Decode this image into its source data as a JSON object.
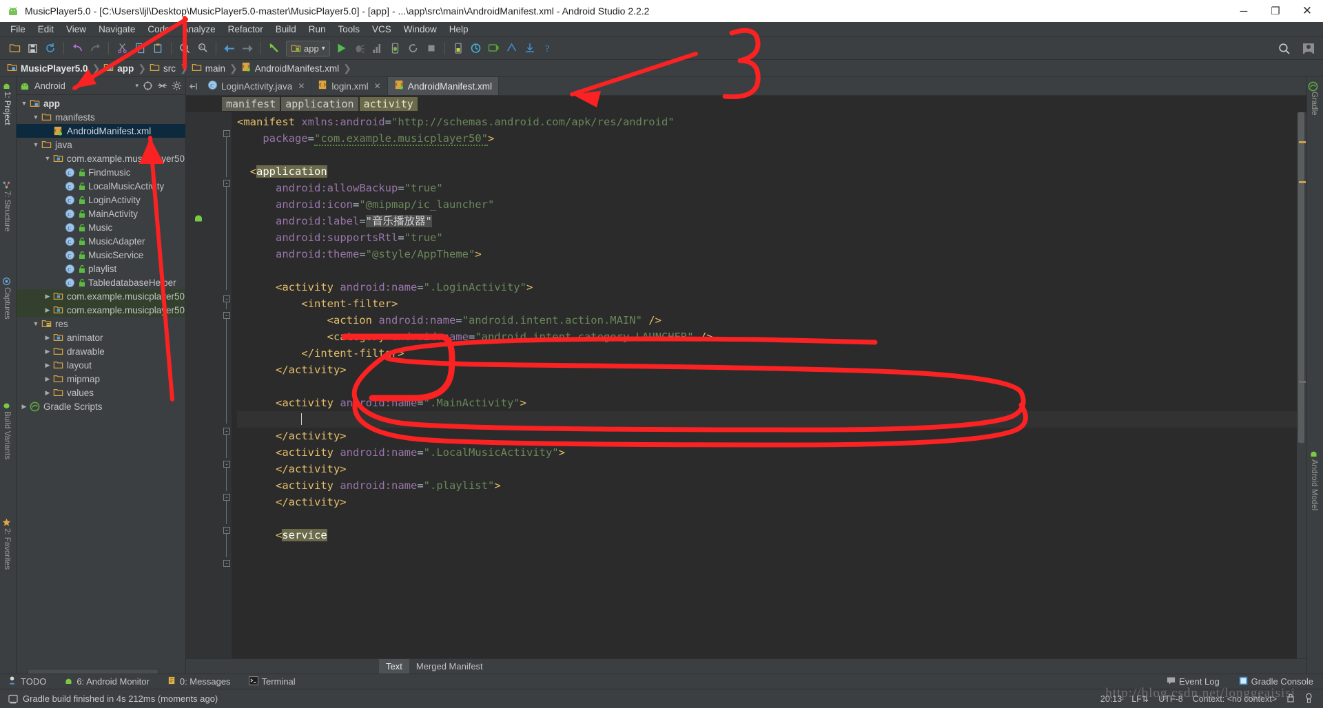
{
  "window": {
    "title": "MusicPlayer5.0 - [C:\\Users\\ljl\\Desktop\\MusicPlayer5.0-master\\MusicPlayer5.0] - [app] - ...\\app\\src\\main\\AndroidManifest.xml - Android Studio 2.2.2",
    "minimize": "─",
    "maximize": "❐",
    "close": "✕"
  },
  "menu": [
    "File",
    "Edit",
    "View",
    "Navigate",
    "Code",
    "Analyze",
    "Refactor",
    "Build",
    "Run",
    "Tools",
    "VCS",
    "Window",
    "Help"
  ],
  "toolbar": {
    "run_config": "app",
    "dropdown_caret": "▾",
    "search_icon": "search-icon",
    "avatar_icon": "user-icon"
  },
  "breadcrumb": [
    {
      "label": "MusicPlayer5.0",
      "icon": "module-folder-icon",
      "bold": true
    },
    {
      "label": "app",
      "icon": "module-folder-icon",
      "bold": true
    },
    {
      "label": "src",
      "icon": "folder-icon",
      "bold": false
    },
    {
      "label": "main",
      "icon": "folder-icon",
      "bold": false
    },
    {
      "label": "AndroidManifest.xml",
      "icon": "manifest-file-icon",
      "bold": false
    }
  ],
  "left_rail": [
    {
      "label": "1: Project",
      "icon": "android-icon",
      "selected": true
    },
    {
      "label": "7: Structure",
      "icon": "structure-icon",
      "selected": false
    },
    {
      "label": "Captures",
      "icon": "captures-icon",
      "selected": false
    },
    {
      "label": "Build Variants",
      "icon": "variants-icon",
      "selected": false
    },
    {
      "label": "2: Favorites",
      "icon": "star-icon",
      "selected": false
    }
  ],
  "right_rail": [
    {
      "label": "Gradle",
      "icon": "gradle-icon"
    },
    {
      "label": "Android Model",
      "icon": "android-model-icon"
    }
  ],
  "project_panel": {
    "view_name": "Android",
    "caret": "▾",
    "tools": [
      "target-icon",
      "collapse-all-icon",
      "gear-icon"
    ],
    "tree": [
      {
        "depth": 0,
        "arrow": "▼",
        "icon": "module-folder-icon",
        "label": "app",
        "bold": true,
        "state": "normal"
      },
      {
        "depth": 1,
        "arrow": "▼",
        "icon": "folder-icon",
        "label": "manifests",
        "bold": false,
        "state": "normal"
      },
      {
        "depth": 2,
        "arrow": "",
        "icon": "manifest-file-icon",
        "label": "AndroidManifest.xml",
        "bold": false,
        "state": "selected"
      },
      {
        "depth": 1,
        "arrow": "▼",
        "icon": "folder-icon",
        "label": "java",
        "bold": false,
        "state": "normal"
      },
      {
        "depth": 2,
        "arrow": "▼",
        "icon": "package-icon",
        "label": "com.example.musicplayer50",
        "bold": false,
        "state": "normal"
      },
      {
        "depth": 3,
        "arrow": "",
        "icon": "class-icon",
        "lock": true,
        "label": "Findmusic",
        "bold": false,
        "state": "normal"
      },
      {
        "depth": 3,
        "arrow": "",
        "icon": "class-icon",
        "lock": true,
        "label": "LocalMusicActivity",
        "bold": false,
        "state": "normal"
      },
      {
        "depth": 3,
        "arrow": "",
        "icon": "class-icon",
        "lock": true,
        "label": "LoginActivity",
        "bold": false,
        "state": "normal"
      },
      {
        "depth": 3,
        "arrow": "",
        "icon": "class-icon",
        "lock": true,
        "label": "MainActivity",
        "bold": false,
        "state": "normal"
      },
      {
        "depth": 3,
        "arrow": "",
        "icon": "class-icon",
        "lock": true,
        "label": "Music",
        "bold": false,
        "state": "normal"
      },
      {
        "depth": 3,
        "arrow": "",
        "icon": "class-icon",
        "lock": true,
        "label": "MusicAdapter",
        "bold": false,
        "state": "normal"
      },
      {
        "depth": 3,
        "arrow": "",
        "icon": "class-icon",
        "lock": true,
        "label": "MusicService",
        "bold": false,
        "state": "normal"
      },
      {
        "depth": 3,
        "arrow": "",
        "icon": "class-icon",
        "lock": true,
        "label": "playlist",
        "bold": false,
        "state": "normal"
      },
      {
        "depth": 3,
        "arrow": "",
        "icon": "class-icon",
        "lock": true,
        "label": "TabledatabaseHelper",
        "bold": false,
        "state": "normal"
      },
      {
        "depth": 2,
        "arrow": "▶",
        "icon": "package-icon",
        "label": "com.example.musicplayer50",
        "bold": false,
        "state": "greenish"
      },
      {
        "depth": 2,
        "arrow": "▶",
        "icon": "package-icon",
        "label": "com.example.musicplayer50",
        "bold": false,
        "state": "greenish"
      },
      {
        "depth": 1,
        "arrow": "▼",
        "icon": "res-folder-icon",
        "label": "res",
        "bold": false,
        "state": "normal"
      },
      {
        "depth": 2,
        "arrow": "▶",
        "icon": "package-icon",
        "label": "animator",
        "bold": false,
        "state": "normal"
      },
      {
        "depth": 2,
        "arrow": "▶",
        "icon": "folder-icon",
        "label": "drawable",
        "bold": false,
        "state": "normal"
      },
      {
        "depth": 2,
        "arrow": "▶",
        "icon": "folder-icon",
        "label": "layout",
        "bold": false,
        "state": "normal"
      },
      {
        "depth": 2,
        "arrow": "▶",
        "icon": "folder-icon",
        "label": "mipmap",
        "bold": false,
        "state": "normal"
      },
      {
        "depth": 2,
        "arrow": "▶",
        "icon": "folder-icon",
        "label": "values",
        "bold": false,
        "state": "normal"
      },
      {
        "depth": 0,
        "arrow": "▶",
        "icon": "gradle-icon",
        "label": "Gradle Scripts",
        "bold": false,
        "state": "normal"
      }
    ]
  },
  "editor": {
    "tabs": [
      {
        "label": "LoginActivity.java",
        "icon": "java-class-icon",
        "active": false,
        "close": "✕"
      },
      {
        "label": "login.xml",
        "icon": "xml-file-icon",
        "active": false,
        "close": "✕"
      },
      {
        "label": "AndroidManifest.xml",
        "icon": "manifest-file-icon",
        "active": true,
        "close": ""
      }
    ],
    "xml_breadcrumb": [
      {
        "label": "manifest",
        "selected": false
      },
      {
        "label": "application",
        "selected": false
      },
      {
        "label": "activity",
        "selected": true
      }
    ],
    "bottom_tabs": [
      {
        "label": "Text",
        "active": true
      },
      {
        "label": "Merged Manifest",
        "active": false
      }
    ],
    "code_lines": [
      {
        "indent": 0,
        "tokens": [
          {
            "t": "<manifest",
            "c": "tag"
          },
          {
            "t": " ",
            "c": "plain"
          },
          {
            "t": "xmlns:android",
            "c": "attr"
          },
          {
            "t": "=",
            "c": "plain"
          },
          {
            "t": "\"http://schemas.android.com/apk/res/android\"",
            "c": "val"
          }
        ]
      },
      {
        "indent": 1,
        "tokens": [
          {
            "t": "    ",
            "c": "plain"
          },
          {
            "t": "package",
            "c": "attr"
          },
          {
            "t": "=",
            "c": "plain"
          },
          {
            "t": "\"com.example.musicplayer50\"",
            "c": "val-squig"
          },
          {
            "t": ">",
            "c": "tag"
          }
        ]
      },
      {
        "indent": 0,
        "tokens": []
      },
      {
        "indent": 0,
        "tokens": [
          {
            "t": "  <",
            "c": "tag"
          },
          {
            "t": "application",
            "c": "hl"
          }
        ]
      },
      {
        "indent": 0,
        "tokens": [
          {
            "t": "      ",
            "c": "plain"
          },
          {
            "t": "android:allowBackup",
            "c": "attr"
          },
          {
            "t": "=",
            "c": "plain"
          },
          {
            "t": "\"true\"",
            "c": "val"
          }
        ]
      },
      {
        "indent": 0,
        "tokens": [
          {
            "t": "      ",
            "c": "plain"
          },
          {
            "t": "android:icon",
            "c": "attr"
          },
          {
            "t": "=",
            "c": "plain"
          },
          {
            "t": "\"@mipmap/ic_launcher\"",
            "c": "val"
          }
        ]
      },
      {
        "indent": 0,
        "tokens": [
          {
            "t": "      ",
            "c": "plain"
          },
          {
            "t": "android:label",
            "c": "attr"
          },
          {
            "t": "=",
            "c": "plain"
          },
          {
            "t": "\"音乐播放器\"",
            "c": "hl2"
          }
        ]
      },
      {
        "indent": 0,
        "tokens": [
          {
            "t": "      ",
            "c": "plain"
          },
          {
            "t": "android:supportsRtl",
            "c": "attr"
          },
          {
            "t": "=",
            "c": "plain"
          },
          {
            "t": "\"true\"",
            "c": "val"
          }
        ]
      },
      {
        "indent": 0,
        "tokens": [
          {
            "t": "      ",
            "c": "plain"
          },
          {
            "t": "android:theme",
            "c": "attr"
          },
          {
            "t": "=",
            "c": "plain"
          },
          {
            "t": "\"@style/AppTheme\"",
            "c": "val"
          },
          {
            "t": ">",
            "c": "tag"
          }
        ]
      },
      {
        "indent": 0,
        "tokens": []
      },
      {
        "indent": 0,
        "tokens": [
          {
            "t": "      <activity",
            "c": "tag"
          },
          {
            "t": " ",
            "c": "plain"
          },
          {
            "t": "android:name",
            "c": "attr"
          },
          {
            "t": "=",
            "c": "plain"
          },
          {
            "t": "\".LoginActivity\"",
            "c": "val"
          },
          {
            "t": ">",
            "c": "tag"
          }
        ]
      },
      {
        "indent": 0,
        "tokens": [
          {
            "t": "          <intent-filter>",
            "c": "tag"
          }
        ]
      },
      {
        "indent": 0,
        "tokens": [
          {
            "t": "              <action",
            "c": "tag"
          },
          {
            "t": " ",
            "c": "plain"
          },
          {
            "t": "android:name",
            "c": "attr"
          },
          {
            "t": "=",
            "c": "plain"
          },
          {
            "t": "\"android.intent.action.MAIN\"",
            "c": "val"
          },
          {
            "t": " />",
            "c": "tag"
          }
        ]
      },
      {
        "indent": 0,
        "tokens": [
          {
            "t": "              <category",
            "c": "tag"
          },
          {
            "t": " ",
            "c": "plain"
          },
          {
            "t": "android:name",
            "c": "attr"
          },
          {
            "t": "=",
            "c": "plain"
          },
          {
            "t": "\"android.intent.category.LAUNCHER\"",
            "c": "val"
          },
          {
            "t": " />",
            "c": "tag"
          }
        ]
      },
      {
        "indent": 0,
        "tokens": [
          {
            "t": "          </intent-filter>",
            "c": "tag"
          }
        ]
      },
      {
        "indent": 0,
        "tokens": [
          {
            "t": "      </activity>",
            "c": "tag"
          }
        ]
      },
      {
        "indent": 0,
        "tokens": []
      },
      {
        "indent": 0,
        "tokens": [
          {
            "t": "      <activity",
            "c": "tag"
          },
          {
            "t": " ",
            "c": "plain"
          },
          {
            "t": "android:name",
            "c": "attr"
          },
          {
            "t": "=",
            "c": "plain"
          },
          {
            "t": "\".MainActivity\"",
            "c": "val"
          },
          {
            "t": ">",
            "c": "tag"
          }
        ]
      },
      {
        "indent": 0,
        "tokens": [
          {
            "t": "          ",
            "c": "plain"
          },
          {
            "t": "|",
            "c": "caret"
          }
        ],
        "current": true
      },
      {
        "indent": 0,
        "tokens": [
          {
            "t": "      </activity>",
            "c": "tag"
          }
        ]
      },
      {
        "indent": 0,
        "tokens": [
          {
            "t": "      <activity",
            "c": "tag"
          },
          {
            "t": " ",
            "c": "plain"
          },
          {
            "t": "android:name",
            "c": "attr"
          },
          {
            "t": "=",
            "c": "plain"
          },
          {
            "t": "\".LocalMusicActivity\"",
            "c": "val"
          },
          {
            "t": ">",
            "c": "tag"
          }
        ]
      },
      {
        "indent": 0,
        "tokens": [
          {
            "t": "      </activity>",
            "c": "tag"
          }
        ]
      },
      {
        "indent": 0,
        "tokens": [
          {
            "t": "      <activity",
            "c": "tag"
          },
          {
            "t": " ",
            "c": "plain"
          },
          {
            "t": "android:name",
            "c": "attr"
          },
          {
            "t": "=",
            "c": "plain"
          },
          {
            "t": "\".playlist\"",
            "c": "val"
          },
          {
            "t": ">",
            "c": "tag"
          }
        ]
      },
      {
        "indent": 0,
        "tokens": [
          {
            "t": "      </activity>",
            "c": "tag"
          }
        ]
      },
      {
        "indent": 0,
        "tokens": []
      },
      {
        "indent": 0,
        "tokens": [
          {
            "t": "      <",
            "c": "tag"
          },
          {
            "t": "service",
            "c": "hl"
          }
        ]
      }
    ]
  },
  "statusbar": {
    "items": [
      {
        "label": "TODO",
        "icon": "todo-icon",
        "mnemonic": ""
      },
      {
        "label": "6: Android Monitor",
        "icon": "android-icon",
        "mnemonic": "6"
      },
      {
        "label": "0: Messages",
        "icon": "messages-icon",
        "mnemonic": "0"
      },
      {
        "label": "Terminal",
        "icon": "terminal-icon",
        "mnemonic": ""
      }
    ],
    "right": [
      {
        "label": "Event Log",
        "icon": "event-log-icon"
      },
      {
        "label": "Gradle Console",
        "icon": "gradle-console-icon"
      }
    ]
  },
  "infobar": {
    "message": "Gradle build finished in 4s 212ms (moments ago)",
    "icon": "build-icon",
    "right": {
      "position": "20:13",
      "line_sep": "LF⇅",
      "encoding": "UTF-8",
      "context": "Context: <no context>",
      "lock_icon": "lock-icon",
      "inspect_icon": "inspection-icon"
    }
  },
  "watermark": "http://blog.csdn.net/longgeaisisi",
  "colors": {
    "accent_red": "#fa2222",
    "editor_bg": "#2b2b2b",
    "panel_bg": "#3c3f41",
    "selection_blue": "#0d293e"
  }
}
